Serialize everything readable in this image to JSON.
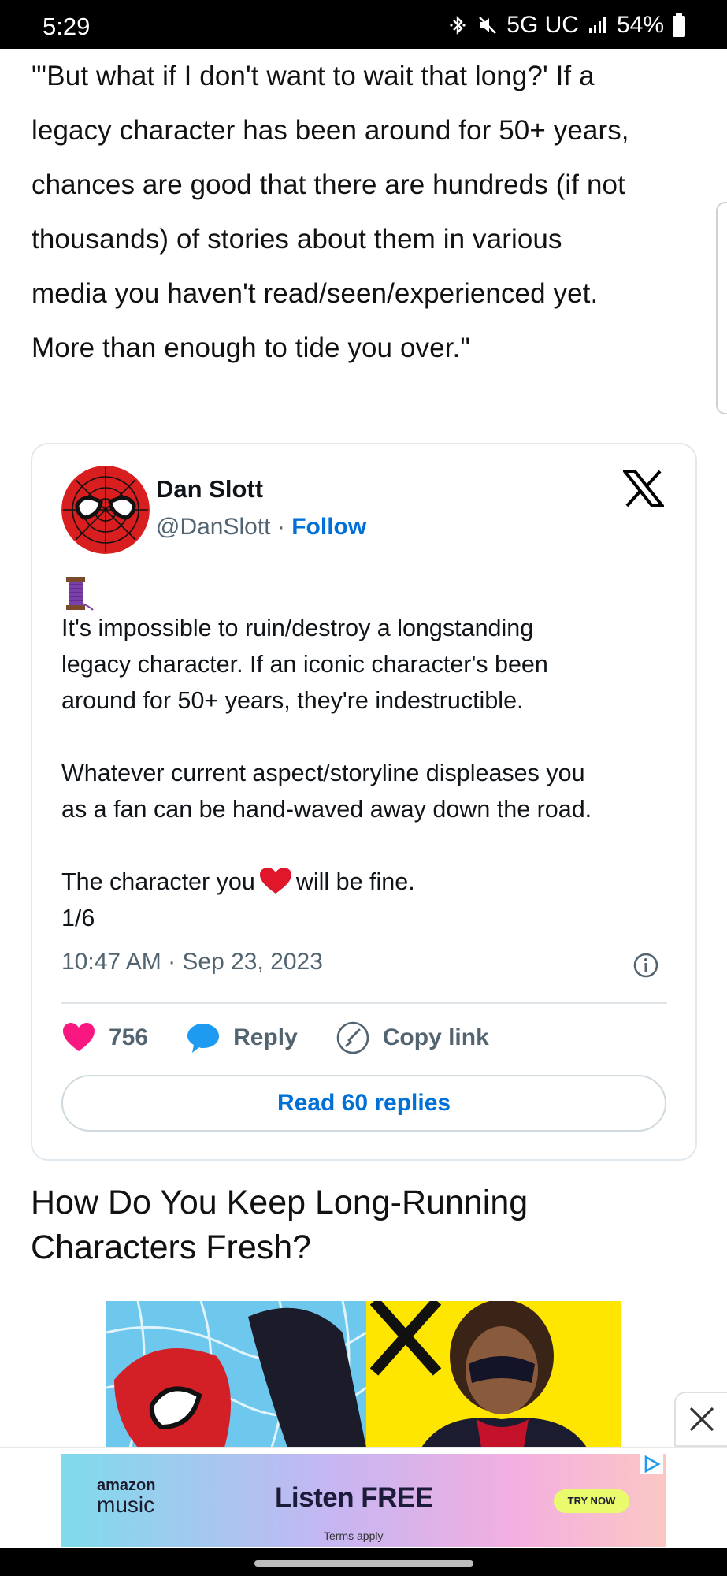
{
  "status_bar": {
    "time": "5:29",
    "network": "5G UC",
    "battery": "54%",
    "icons": [
      "bluetooth-icon",
      "mute-icon",
      "signal-icon",
      "battery-icon"
    ]
  },
  "article": {
    "paragraph_lines": [
      "\"'But what if I don't want to wait that long?' If a",
      "legacy character has been around for 50+ years,",
      "chances are good that there are hundreds (if not",
      "thousands) of stories about them in various",
      "media you haven't read/seen/experienced yet.",
      "More than enough to tide you over.\""
    ],
    "section_heading": "How Do You Keep Long-Running Characters Fresh?"
  },
  "tweet": {
    "author_name": "Dan Slott",
    "handle": "@DanSlott",
    "separator": " · ",
    "follow_label": "Follow",
    "text_p1_lines": [
      "It's impossible to ruin/destroy a longstanding",
      "legacy character. If an iconic character's been",
      "around for 50+ years, they're indestructible."
    ],
    "text_p2_lines": [
      "Whatever current aspect/storyline displeases you",
      "as a fan can be hand-waved away down the road."
    ],
    "text_p3_before": "The character you",
    "text_p3_after": "will be fine.",
    "text_p3_count": "1/6",
    "timestamp": "10:47 AM · Sep 23, 2023",
    "likes": "756",
    "reply_label": "Reply",
    "copy_link_label": "Copy link",
    "read_replies_label": "Read 60 replies"
  },
  "ad": {
    "brand_line1": "amazon",
    "brand_line2": "music",
    "headline": "Listen FREE",
    "cta": "TRY NOW",
    "terms": "Terms apply"
  },
  "colors": {
    "link_blue": "#006fd6",
    "like_pink": "#f91880",
    "reply_blue": "#1d9bf0",
    "muted_gray": "#536471"
  }
}
